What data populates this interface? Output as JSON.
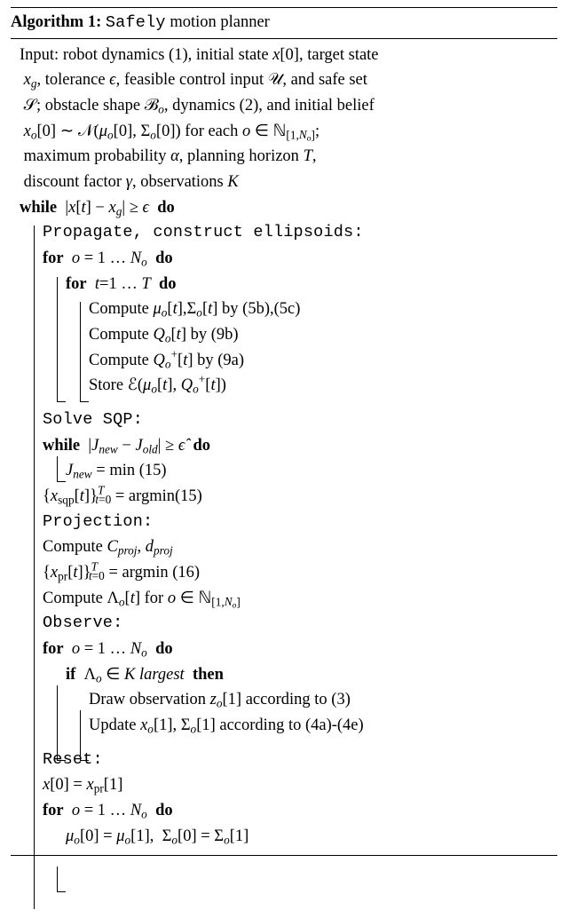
{
  "header": {
    "algo_label": "Algorithm 1:",
    "algo_name": "Safely",
    "algo_rest": " motion planner"
  },
  "input": {
    "l1": "robot dynamics (1), initial state x[0], target state",
    "l2": "xg, tolerance ϵ, feasible control input 𝒰, and safe set",
    "l3": "𝒮; obstacle shape ℬo, dynamics (2), and initial belief",
    "l4": "xo[0] ∼ 𝒩(μo[0], Σo[0]) for each o ∈ ℕ[1,No];",
    "l5": "maximum probability α, planning horizon T,",
    "l6": "discount factor γ, observations K"
  },
  "lines": {
    "while_main": "|x[t] − xg| ≥ ϵ",
    "propagate": "Propagate, construct ellipsoids:",
    "for_o1": "o = 1 … No",
    "for_t": "t=1 … T",
    "compute_mu": "Compute μo[t], Σo[t] by (5b),(5c)",
    "compute_q": "Compute Qo[t] by (9b)",
    "compute_qplus": "Compute Qo+[t] by (9a)",
    "store_e": "Store ℰ(μo[t], Qo+[t])",
    "solve_sqp": "Solve SQP:",
    "while_j": "|Jnew − Jold| ≥ ϵ̂",
    "jnew": "Jnew = min (15)",
    "xsqp": "{xsqp[t]}  = argmin(15)",
    "projection": "Projection:",
    "compute_cd": "Compute Cproj, dproj",
    "xpr": "{xpr[t]}  = argmin (16)",
    "compute_lambda": "Compute Λo[t] for o ∈ ℕ[1,No]",
    "observe": "Observe:",
    "for_o2": "o = 1 … No",
    "if_lambda": "Λo ∈ K largest",
    "draw_obs": "Draw observation zo[1] according to (3)",
    "update_xo": "Update xo[1], Σo[1] according to (4a)-(4e)",
    "reset": "Reset:",
    "x0": "x[0] = xpr[1]",
    "for_o3": "o = 1 … No",
    "mu_assign": "μo[0] = μo[1],  Σo[0] = Σo[1]"
  },
  "kw": {
    "input": "Input:",
    "while": "while",
    "for": "for",
    "if": "if",
    "then": "then",
    "do": "do"
  }
}
